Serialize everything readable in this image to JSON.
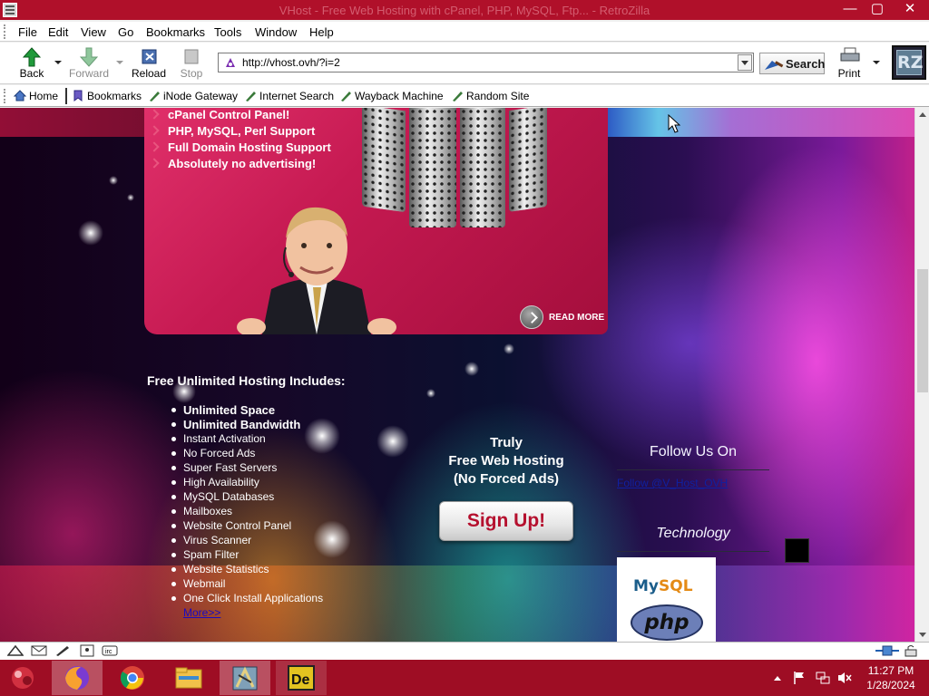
{
  "window": {
    "title": "VHost - Free Web Hosting with cPanel, PHP, MySQL, Ftp... - RetroZilla",
    "colors": {
      "titlebar": "#b0102a",
      "taskbar": "#9e0d24"
    }
  },
  "menu": [
    "File",
    "Edit",
    "View",
    "Go",
    "Bookmarks",
    "Tools",
    "Window",
    "Help"
  ],
  "toolbar": {
    "back": "Back",
    "forward": "Forward",
    "reload": "Reload",
    "stop": "Stop",
    "url": "http://vhost.ovh/?i=2",
    "search": "Search",
    "print": "Print",
    "logo": "RZ"
  },
  "bookmarks_bar": [
    "Home",
    "Bookmarks",
    "iNode Gateway",
    "Internet Search",
    "Wayback Machine",
    "Random Site"
  ],
  "page": {
    "banner_items": [
      "cPanel Control Panel!",
      "PHP, MySQL, Perl Support",
      "Full Domain Hosting Support",
      "Absolutely no advertising!"
    ],
    "read_more": "READ MORE",
    "hosting_title": "Free Unlimited Hosting Includes:",
    "features": [
      "Unlimited Space",
      "Unlimited Bandwidth",
      "Instant Activation",
      "No Forced Ads",
      "Super Fast Servers",
      "High Availability",
      "MySQL Databases",
      "Mailboxes",
      "Website Control Panel",
      "Virus Scanner",
      "Spam Filter",
      "Website Statistics",
      "Webmail",
      "One Click Install Applications"
    ],
    "more_link": "More>>",
    "truly_line1": "Truly",
    "truly_line2": "Free Web Hosting",
    "truly_line3": "(No Forced Ads)",
    "signup": "Sign Up!",
    "follow_title": "Follow Us On",
    "follow_link": "Follow @V_Host_OVH",
    "tech_title": "Technology",
    "tech_mysql_a": "My",
    "tech_mysql_b": "SQL",
    "tech_php": "php"
  },
  "taskbar": {
    "time": "11:27 PM",
    "date": "1/28/2024",
    "apps": [
      "firefox",
      "chrome",
      "file-explorer",
      "retrozilla",
      "dreamweaver"
    ]
  }
}
